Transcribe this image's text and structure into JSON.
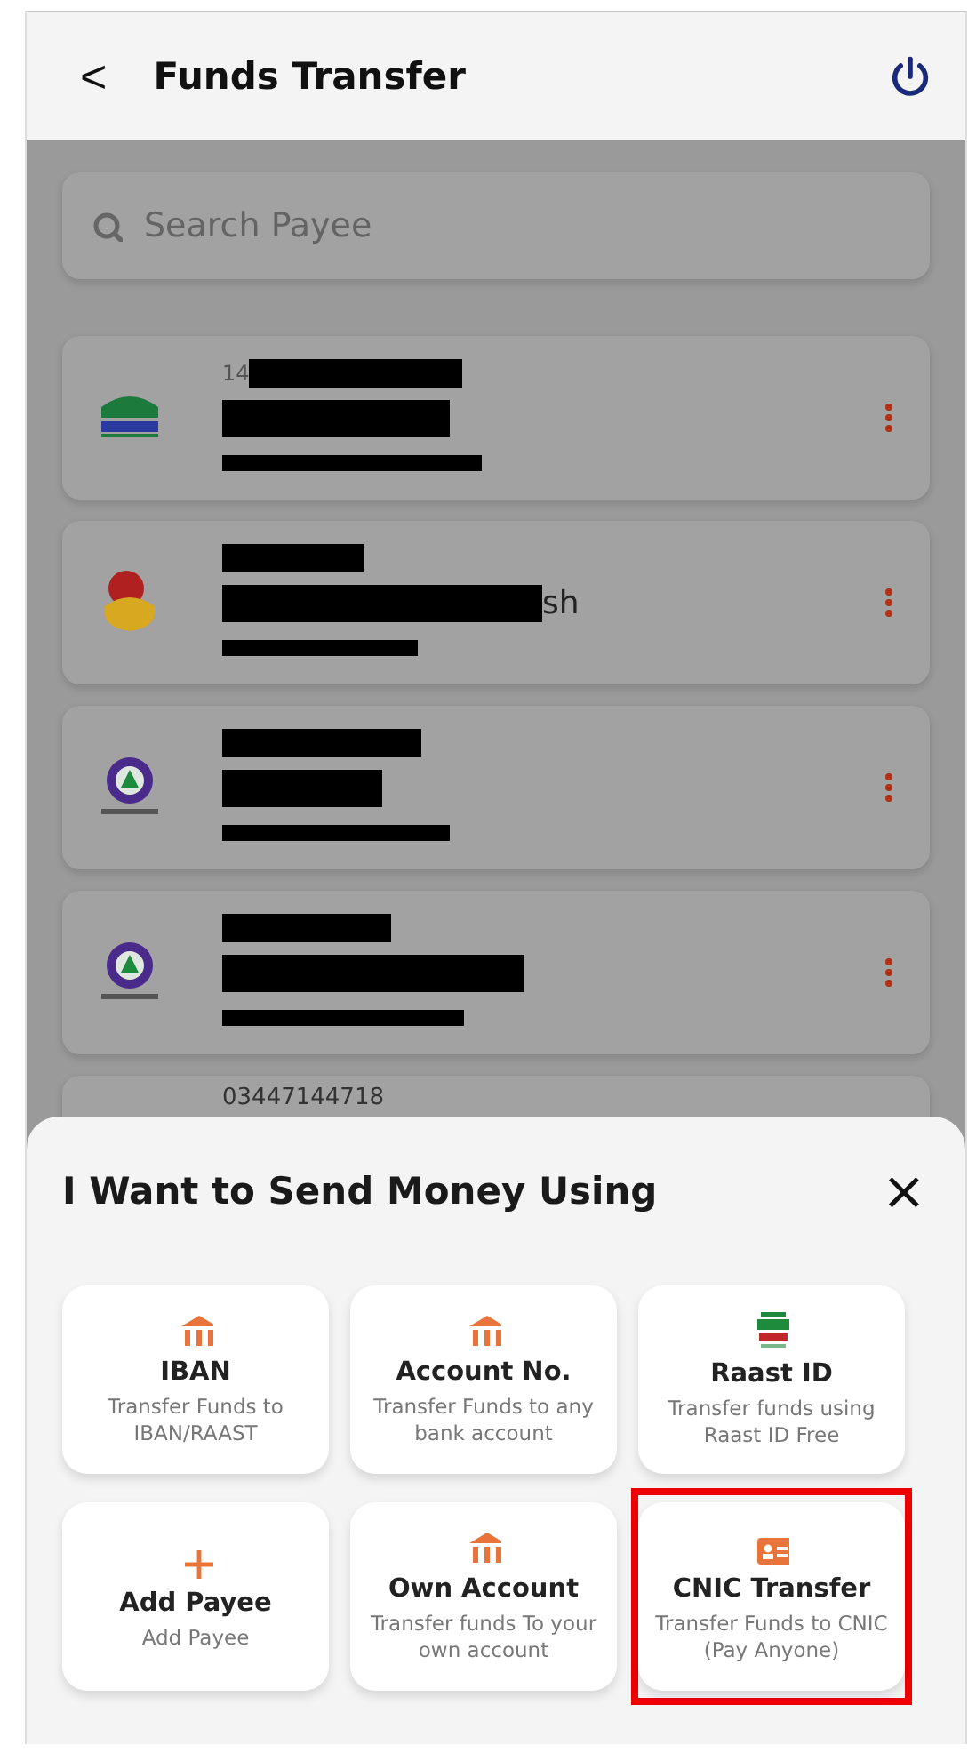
{
  "header": {
    "back": "<",
    "title": "Funds Transfer"
  },
  "search": {
    "placeholder": "Search Payee"
  },
  "payees": [
    {
      "kind": "green",
      "lines": [
        {
          "text": "14",
          "redacted": true
        },
        {
          "redacted": true
        },
        {
          "redacted": true
        }
      ]
    },
    {
      "kind": "yellow",
      "lines": [
        {
          "redacted": true
        },
        {
          "text": "sh",
          "redacted": true
        },
        {
          "redacted": true
        }
      ]
    },
    {
      "kind": "purple",
      "lines": [
        {
          "redacted": true
        },
        {
          "redacted": true
        },
        {
          "redacted": true
        }
      ]
    },
    {
      "kind": "purple",
      "lines": [
        {
          "redacted": true
        },
        {
          "redacted": true
        },
        {
          "redacted": true
        }
      ]
    },
    {
      "lines": [
        {
          "text": "03447144718",
          "redacted": false
        }
      ]
    }
  ],
  "sheet": {
    "title": "I Want to Send Money Using",
    "close": "×",
    "options": [
      {
        "kind": "bank",
        "title": "IBAN",
        "subtitle": "Transfer Funds to IBAN/RAAST",
        "highlighted": false
      },
      {
        "kind": "bank",
        "title": "Account No.",
        "subtitle": "Transfer Funds to any bank account",
        "highlighted": false
      },
      {
        "kind": "raast",
        "title": "Raast ID",
        "subtitle": "Transfer funds using Raast ID Free",
        "highlighted": false
      },
      {
        "kind": "plus",
        "title": "Add Payee",
        "subtitle": "Add Payee",
        "highlighted": false
      },
      {
        "kind": "bank",
        "title": "Own Account",
        "subtitle": "Transfer funds To your own account",
        "highlighted": false
      },
      {
        "kind": "card",
        "title": "CNIC Transfer",
        "subtitle": "Transfer Funds to CNIC (Pay Anyone)",
        "highlighted": true
      }
    ]
  }
}
